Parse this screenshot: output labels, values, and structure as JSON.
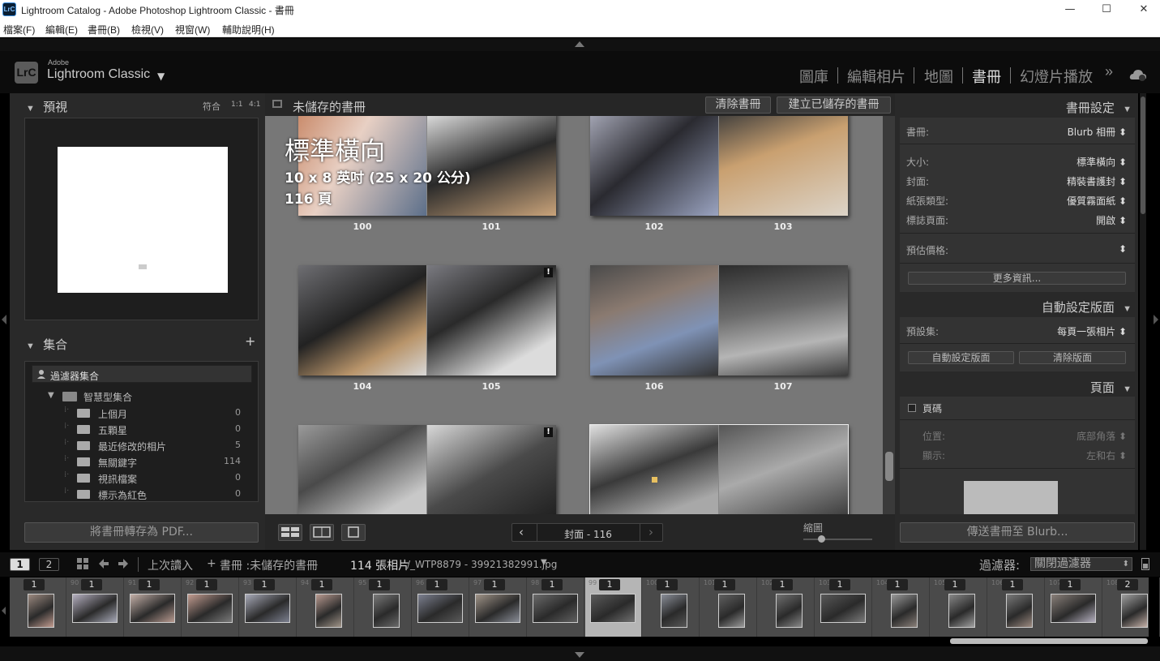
{
  "window": {
    "title": "Lightroom Catalog - Adobe Photoshop Lightroom Classic - 書冊",
    "app_icon": "LrC",
    "minimize": "—",
    "maximize": "☐",
    "close": "✕"
  },
  "menu": [
    "檔案(F)",
    "編輯(E)",
    "書冊(B)",
    "檢視(V)",
    "視窗(W)",
    "輔助說明(H)"
  ],
  "identity": {
    "badge": "LrC",
    "adobe": "Adobe",
    "product": "Lightroom Classic",
    "arrow": "▼",
    "modules": [
      "圖庫",
      "編輯相片",
      "地圖",
      "書冊",
      "幻燈片播放"
    ],
    "active_module": "書冊",
    "more": "»"
  },
  "left_panel": {
    "preview_title": "預視",
    "preview_zoom": [
      "符合",
      "1:1",
      "4:1"
    ],
    "collections_title": "集合",
    "add": "+",
    "filter_label": "過濾器集合",
    "smart_group": "智慧型集合",
    "collections": [
      {
        "name": "上個月",
        "count": "0"
      },
      {
        "name": "五顆星",
        "count": "0"
      },
      {
        "name": "最近修改的相片",
        "count": "5"
      },
      {
        "name": "無關鍵字",
        "count": "114"
      },
      {
        "name": "視訊檔案",
        "count": "0"
      },
      {
        "name": "標示為紅色",
        "count": "0"
      }
    ],
    "export_pdf": "將書冊轉存為 PDF..."
  },
  "center": {
    "book_title": "未儲存的書冊",
    "clear_book": "清除書冊",
    "create_saved": "建立已儲存的書冊",
    "overlay_line1": "標準橫向",
    "overlay_line2": "10 x 8 英吋 (25 x 20 公分)",
    "overlay_line3": "116 頁",
    "page_numbers": [
      "100",
      "101",
      "102",
      "103",
      "104",
      "105",
      "106",
      "107"
    ],
    "nav_prev": "‹",
    "nav_label": "封面 - 116",
    "nav_next": "›",
    "zoom_label": "縮圖"
  },
  "right_panel": {
    "book_settings_title": "書冊設定",
    "book_label": "書冊:",
    "book_value": "Blurb 相冊",
    "size_label": "大小:",
    "size_value": "標準橫向",
    "cover_label": "封面:",
    "cover_value": "精裝書護封",
    "paper_label": "紙張類型:",
    "paper_value": "優質霧面紙",
    "logo_label": "標誌頁面:",
    "logo_value": "開啟",
    "price_label": "預估價格:",
    "more_info": "更多資訊...",
    "autolayout_title": "自動設定版面",
    "preset_label": "預設集:",
    "preset_value": "每頁一張相片",
    "autolayout_btn": "自動設定版面",
    "clear_layout_btn": "清除版面",
    "page_title": "頁面",
    "page_numbers_label": "頁碼",
    "position_label": "位置:",
    "position_value": "底部角落",
    "display_label": "顯示:",
    "display_value": "左和右",
    "send_blurb": "傳送書冊至 Blurb..."
  },
  "filmbar": {
    "view1": "1",
    "view2": "2",
    "previous_import": "上次讀入",
    "plus": "+",
    "path": "書冊 :未儲存的書冊",
    "count": "114 張相片",
    "file": "/_WTP8879 - 39921382991.jpg",
    "filter_label": "過濾器:",
    "filter_value": "關閉過濾器"
  },
  "filmstrip": {
    "cells": [
      {
        "num": "",
        "badge": "1"
      },
      {
        "num": "90",
        "badge": "1"
      },
      {
        "num": "91",
        "badge": "1"
      },
      {
        "num": "92",
        "badge": "1"
      },
      {
        "num": "93",
        "badge": "1"
      },
      {
        "num": "94",
        "badge": "1"
      },
      {
        "num": "95",
        "badge": "1"
      },
      {
        "num": "96",
        "badge": "1"
      },
      {
        "num": "97",
        "badge": "1"
      },
      {
        "num": "98",
        "badge": "1"
      },
      {
        "num": "99",
        "badge": "1"
      },
      {
        "num": "100",
        "badge": "1"
      },
      {
        "num": "101",
        "badge": "1"
      },
      {
        "num": "102",
        "badge": "1"
      },
      {
        "num": "103",
        "badge": "1"
      },
      {
        "num": "104",
        "badge": "1"
      },
      {
        "num": "105",
        "badge": "1"
      },
      {
        "num": "106",
        "badge": "1"
      },
      {
        "num": "107",
        "badge": "1"
      },
      {
        "num": "108",
        "badge": "2"
      }
    ],
    "selected_index": 10
  }
}
